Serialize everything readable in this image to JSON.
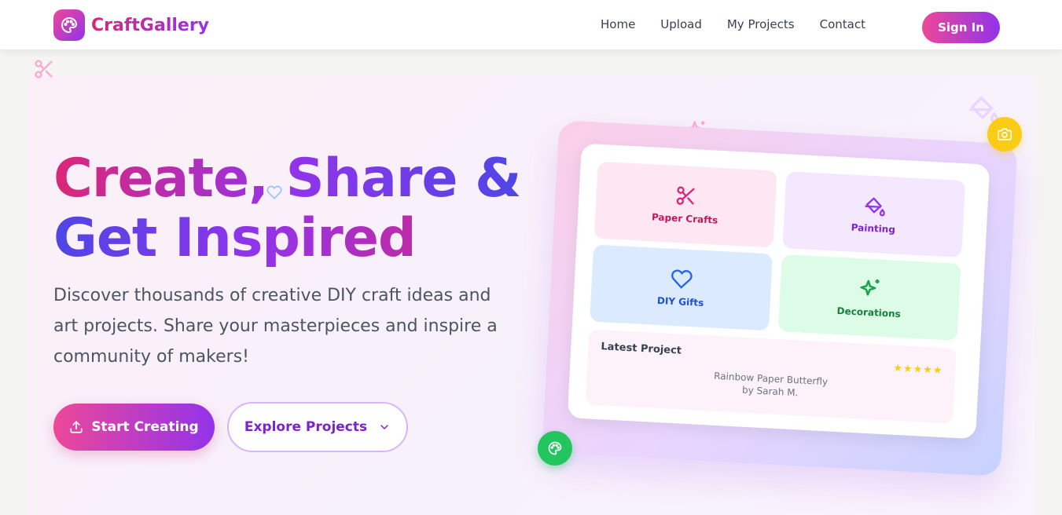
{
  "brand": {
    "name": "CraftGallery",
    "logo_icon": "palette-icon"
  },
  "nav": {
    "links": [
      "Home",
      "Upload",
      "My Projects",
      "Contact"
    ],
    "signin_label": "Sign In"
  },
  "hero": {
    "headline_line1": "Create, Share &",
    "headline_line2": "Get Inspired",
    "lead": "Discover thousands of creative DIY craft ideas and art projects. Share your masterpieces and inspire a community of makers!",
    "primary_label": "Start Creating",
    "primary_icon": "upload-icon",
    "secondary_label": "Explore Projects",
    "secondary_icon": "chevron-down-icon"
  },
  "showcase": {
    "categories": [
      {
        "label": "Paper Crafts",
        "icon": "scissors-icon"
      },
      {
        "label": "Painting",
        "icon": "paint-bucket-icon"
      },
      {
        "label": "DIY Gifts",
        "icon": "heart-icon"
      },
      {
        "label": "Decorations",
        "icon": "sparkles-icon"
      }
    ],
    "latest": {
      "title": "Latest Project",
      "rating": "★★★★★",
      "project_name": "Rainbow Paper Butterfly",
      "author": "by Sarah M."
    }
  },
  "colors": {
    "brand_pink": "#ec4899",
    "brand_purple": "#9333ea",
    "camera_badge": "#facc15",
    "palette_badge": "#22c55e"
  }
}
